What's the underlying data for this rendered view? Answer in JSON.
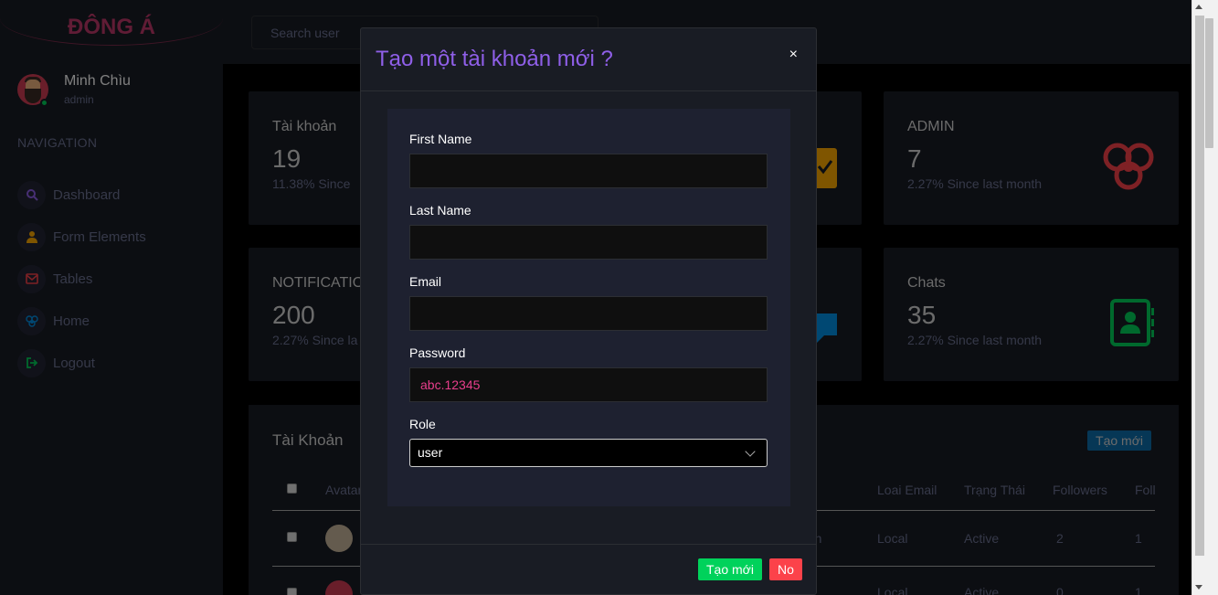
{
  "sidebar": {
    "brand": "ĐÔNG Á",
    "profile": {
      "name": "Minh Chìu",
      "role": "admin"
    },
    "nav_heading": "NAVIGATION",
    "items": [
      {
        "label": "Dashboard",
        "icon": "search-icon",
        "color": "#8f5fe8"
      },
      {
        "label": "Form Elements",
        "icon": "user-icon",
        "color": "#ffab00"
      },
      {
        "label": "Tables",
        "icon": "mail-icon",
        "color": "#fc424a"
      },
      {
        "label": "Home",
        "icon": "biohazard-icon",
        "color": "#0090e7"
      },
      {
        "label": "Logout",
        "icon": "logout-icon",
        "color": "#00d25b"
      }
    ]
  },
  "topbar": {
    "search_placeholder": "Search user"
  },
  "cards": [
    {
      "title": "Tài khoản",
      "value": "19",
      "sub": "11.38% Since"
    },
    {
      "title": "ADMIN",
      "value": "7",
      "sub": "2.27% Since last month",
      "icon_color": "#fc424a"
    },
    {
      "title": "NOTIFICATIO",
      "value": "200",
      "sub": "2.27% Since la"
    },
    {
      "title": "Chats",
      "value": "35",
      "sub": "2.27% Since last month",
      "icon_color": "#00d25b"
    }
  ],
  "table": {
    "title": "Tài Khoản",
    "new_button": "Tạo mới",
    "headers": [
      "Avatar",
      "Loai Email",
      "Trạng Thái",
      "Followers",
      "Foll"
    ],
    "rows": [
      {
        "partial": "rn",
        "email_type": "Local",
        "status": "Active",
        "followers": "2",
        "following": "1"
      },
      {
        "partial": "",
        "email_type": "Local",
        "status": "Active",
        "followers": "0",
        "following": "1"
      }
    ]
  },
  "modal": {
    "title": "Tạo một tài khoản mới ?",
    "close": "×",
    "fields": {
      "first_name": {
        "label": "First Name",
        "value": ""
      },
      "last_name": {
        "label": "Last Name",
        "value": ""
      },
      "email": {
        "label": "Email",
        "value": ""
      },
      "password": {
        "label": "Password",
        "value": "abc.12345"
      },
      "role": {
        "label": "Role",
        "value": "user"
      }
    },
    "buttons": {
      "create": "Tạo mới",
      "no": "No"
    }
  }
}
